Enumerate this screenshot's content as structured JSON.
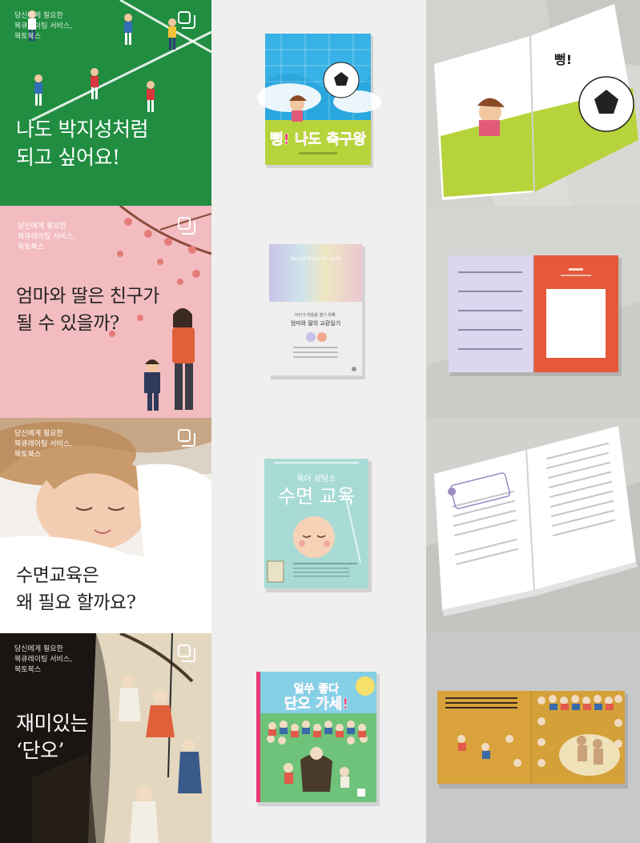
{
  "promos": [
    {
      "tagline": [
        "당신에게 필요한",
        "북큐레이팅 서비스,",
        "북토북스"
      ],
      "headline": [
        "나도 박지성처럼",
        "되고 싶어요!"
      ]
    },
    {
      "tagline": [
        "당신에게 필요한",
        "북큐레이팅 서비스,",
        "북토북스"
      ],
      "headline": [
        "엄마와 딸은 친구가",
        "될 수 있을까?"
      ]
    },
    {
      "tagline": [
        "당신에게 필요한",
        "북큐레이팅 서비스,",
        "북토북스"
      ],
      "headline": [
        "수면교육은",
        "왜 필요 할까요?"
      ]
    },
    {
      "tagline": [
        "당신에게 필요한",
        "북큐레이팅 서비스,",
        "북토북스"
      ],
      "headline": [
        "재미있는",
        "‘단오’"
      ]
    }
  ],
  "books": [
    {
      "title": "뻥! 나도 축구왕",
      "colors": {
        "sky": "#2aa7de",
        "grass": "#b7d33b",
        "title": "#ed1c6f"
      }
    },
    {
      "title_en": "Secret Diary for Girls",
      "subtitle": "아이가 마음을 열기 위해,",
      "title": "엄마와 딸의 교환일기",
      "colors": {
        "band": "#c8c0e6",
        "body": "#efeeec"
      }
    },
    {
      "series": "육아 상담소",
      "title": "수면 교육",
      "colors": {
        "bg": "#a8dbd6",
        "text": "#ffffff"
      }
    },
    {
      "title": "얼쑤 좋다 단오 가세!",
      "colors": {
        "bg": "#5fb86a",
        "title": "#e83a77"
      }
    }
  ],
  "spreads": [
    {
      "heading": "뻥!"
    },
    {
      "heading": ""
    },
    {
      "heading": ""
    },
    {
      "heading": ""
    }
  ]
}
